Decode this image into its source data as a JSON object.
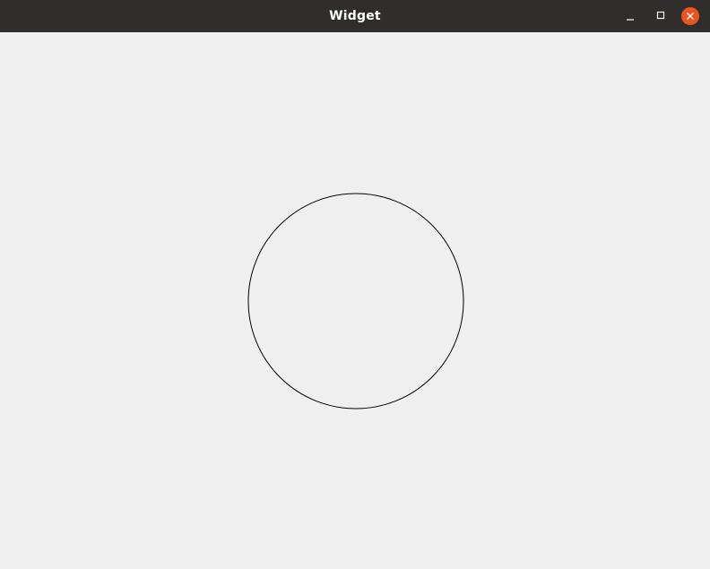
{
  "window": {
    "title": "Widget",
    "controls": {
      "minimize_icon": "minimize-icon",
      "maximize_icon": "maximize-icon",
      "close_icon": "close-icon",
      "close_color": "#e95420"
    }
  },
  "canvas": {
    "background": "#efefef",
    "shape": "circle",
    "stroke_color": "#000000"
  }
}
